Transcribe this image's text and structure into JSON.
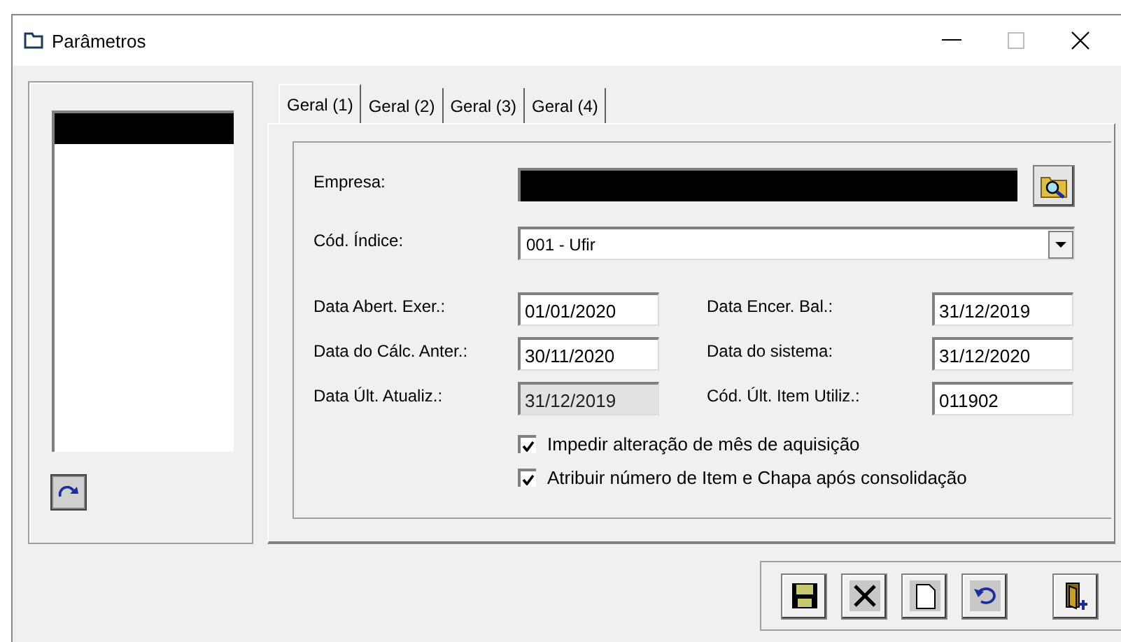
{
  "window": {
    "title": "Parâmetros"
  },
  "side_list": {
    "items": [
      {
        "redacted": true
      }
    ]
  },
  "tabs": [
    {
      "label": "Geral (1)",
      "selected": true
    },
    {
      "label": "Geral (2)",
      "selected": false
    },
    {
      "label": "Geral (3)",
      "selected": false
    },
    {
      "label": "Geral (4)",
      "selected": false
    }
  ],
  "empresa": {
    "label": "Empresa:",
    "redacted": true
  },
  "indice": {
    "label": "Cód. Índice:",
    "value": "001 - Ufir"
  },
  "dates": [
    {
      "label": "Data Abert. Exer.:",
      "value": "01/01/2020",
      "disabled": false
    },
    {
      "label": "Data Encer. Bal.:",
      "value": "31/12/2019",
      "disabled": false
    },
    {
      "label": "Data do Cálc. Anter.:",
      "value": "30/11/2020",
      "disabled": false
    },
    {
      "label": "Data do sistema:",
      "value": "31/12/2020",
      "disabled": false
    },
    {
      "label": "Data Últ. Atualiz.:",
      "value": "31/12/2019",
      "disabled": true
    },
    {
      "label": "Cód. Últ. Item Utiliz.:",
      "value": "011902",
      "disabled": false
    }
  ],
  "options": [
    {
      "label": "Impedir alteração de mês de aquisição",
      "checked": true
    },
    {
      "label": "Atribuir número de Item e Chapa após consolidação",
      "checked": true
    }
  ],
  "toolbar": [
    {
      "kind": "save"
    },
    {
      "kind": "delete"
    },
    {
      "kind": "new"
    },
    {
      "kind": "undo"
    },
    {
      "kind": "exit"
    }
  ]
}
